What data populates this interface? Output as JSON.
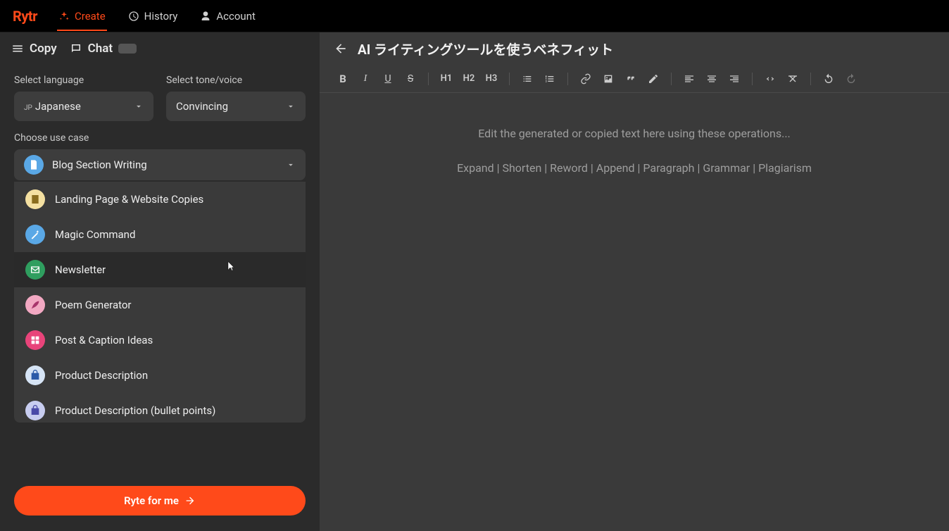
{
  "nav": {
    "logo_text": "Rytr",
    "items": [
      {
        "label": "Create",
        "icon": "sparkle"
      },
      {
        "label": "History",
        "icon": "clock"
      },
      {
        "label": "Account",
        "icon": "person"
      }
    ]
  },
  "secondary_bar": {
    "copy_label": "Copy",
    "chat_label": "Chat"
  },
  "sidebar": {
    "language_label": "Select language",
    "language_prefix": "JP",
    "language_value": "Japanese",
    "tone_label": "Select tone/voice",
    "tone_value": "Convincing",
    "usecase_label": "Choose use case",
    "usecase_selected": "Blog Section Writing",
    "usecase_options": [
      {
        "label": "Landing Page & Website Copies",
        "icon_bg": "#f4e0a1",
        "icon": "page",
        "icon_fg": "#8a6d1e"
      },
      {
        "label": "Magic Command",
        "icon_bg": "#5aa8e6",
        "icon": "wand",
        "icon_fg": "#ffffff"
      },
      {
        "label": "Newsletter",
        "icon_bg": "#2f9e5f",
        "icon": "mail",
        "icon_fg": "#ffffff",
        "hovered": true
      },
      {
        "label": "Poem Generator",
        "icon_bg": "#f2a8c2",
        "icon": "feather",
        "icon_fg": "#a8346b"
      },
      {
        "label": "Post & Caption Ideas",
        "icon_bg": "#e8447a",
        "icon": "grid",
        "icon_fg": "#ffffff"
      },
      {
        "label": "Product Description",
        "icon_bg": "#d6e4f5",
        "icon": "bag",
        "icon_fg": "#2a5aa8"
      },
      {
        "label": "Product Description (bullet points)",
        "icon_bg": "#c8cdf0",
        "icon": "bag",
        "icon_fg": "#4a4aa8"
      }
    ],
    "cta_label": "Ryte for me"
  },
  "editor": {
    "title": "AI ライティングツールを使うベネフィット",
    "toolbar": {
      "bold": "B",
      "italic": "I",
      "underline": "U",
      "strike": "S",
      "h1": "H1",
      "h2": "H2",
      "h3": "H3"
    },
    "placeholder": "Edit the generated or copied text here using these operations...",
    "operations": "Expand | Shorten | Reword | Append | Paragraph | Grammar | Plagiarism"
  },
  "icons": {
    "usecase_selected_bg": "#5aa8e6"
  }
}
